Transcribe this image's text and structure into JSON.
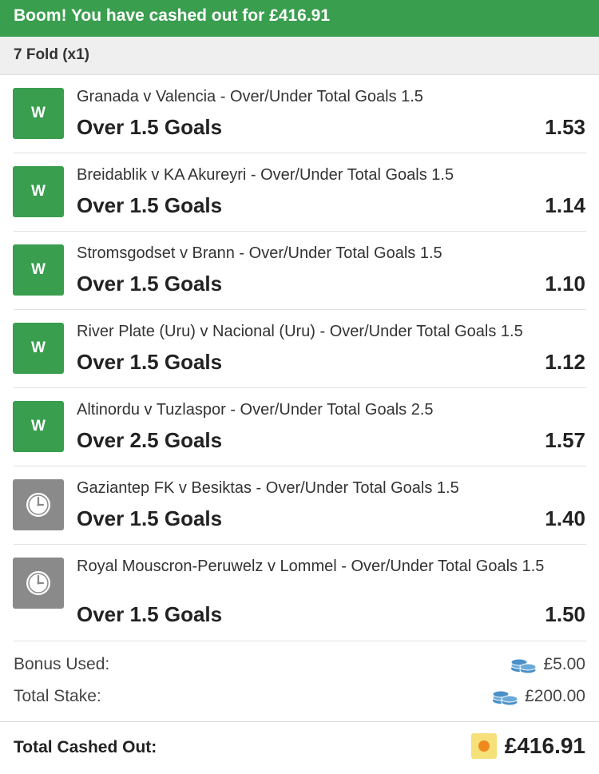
{
  "banner": {
    "message": "Boom! You have cashed out for £416.91"
  },
  "bet": {
    "title": "7 Fold (x1)"
  },
  "legs": [
    {
      "status": "won",
      "badge": "W",
      "match": "Granada v Valencia - Over/Under Total Goals 1.5",
      "selection": "Over 1.5 Goals",
      "odds": "1.53"
    },
    {
      "status": "won",
      "badge": "W",
      "match": "Breidablik v KA Akureyri - Over/Under Total Goals 1.5",
      "selection": "Over 1.5 Goals",
      "odds": "1.14"
    },
    {
      "status": "won",
      "badge": "W",
      "match": "Stromsgodset v Brann - Over/Under Total Goals 1.5",
      "selection": "Over 1.5 Goals",
      "odds": "1.10"
    },
    {
      "status": "won",
      "badge": "W",
      "match": "River Plate (Uru) v Nacional (Uru) - Over/Under Total Goals 1.5",
      "selection": "Over 1.5 Goals",
      "odds": "1.12"
    },
    {
      "status": "won",
      "badge": "W",
      "match": "Altinordu v Tuzlaspor - Over/Under Total Goals 2.5",
      "selection": "Over 2.5 Goals",
      "odds": "1.57"
    },
    {
      "status": "pending",
      "badge": "",
      "match": "Gaziantep FK v Besiktas - Over/Under Total Goals 1.5",
      "selection": "Over 1.5 Goals",
      "odds": "1.40"
    },
    {
      "status": "pending",
      "badge": "",
      "match": "Royal Mouscron-Peruwelz v Lommel - Over/Under Total Goals 1.5",
      "selection": "Over 1.5 Goals",
      "odds": "1.50"
    }
  ],
  "summary": {
    "bonus_label": "Bonus Used:",
    "bonus_value": "£5.00",
    "stake_label": "Total Stake:",
    "stake_value": "£200.00",
    "cashed_label": "Total Cashed Out:",
    "cashed_value": "£416.91"
  },
  "colors": {
    "win": "#3a9e4f",
    "pending": "#8a8a8a",
    "cash_icon_bg": "#f6e07a",
    "cash_icon_dot": "#ef8a1f",
    "coins": "#4a90c9"
  },
  "icons": {
    "win": "won-badge",
    "pending": "clock-icon",
    "stake": "coins-icon",
    "cashout": "cashout-icon"
  }
}
